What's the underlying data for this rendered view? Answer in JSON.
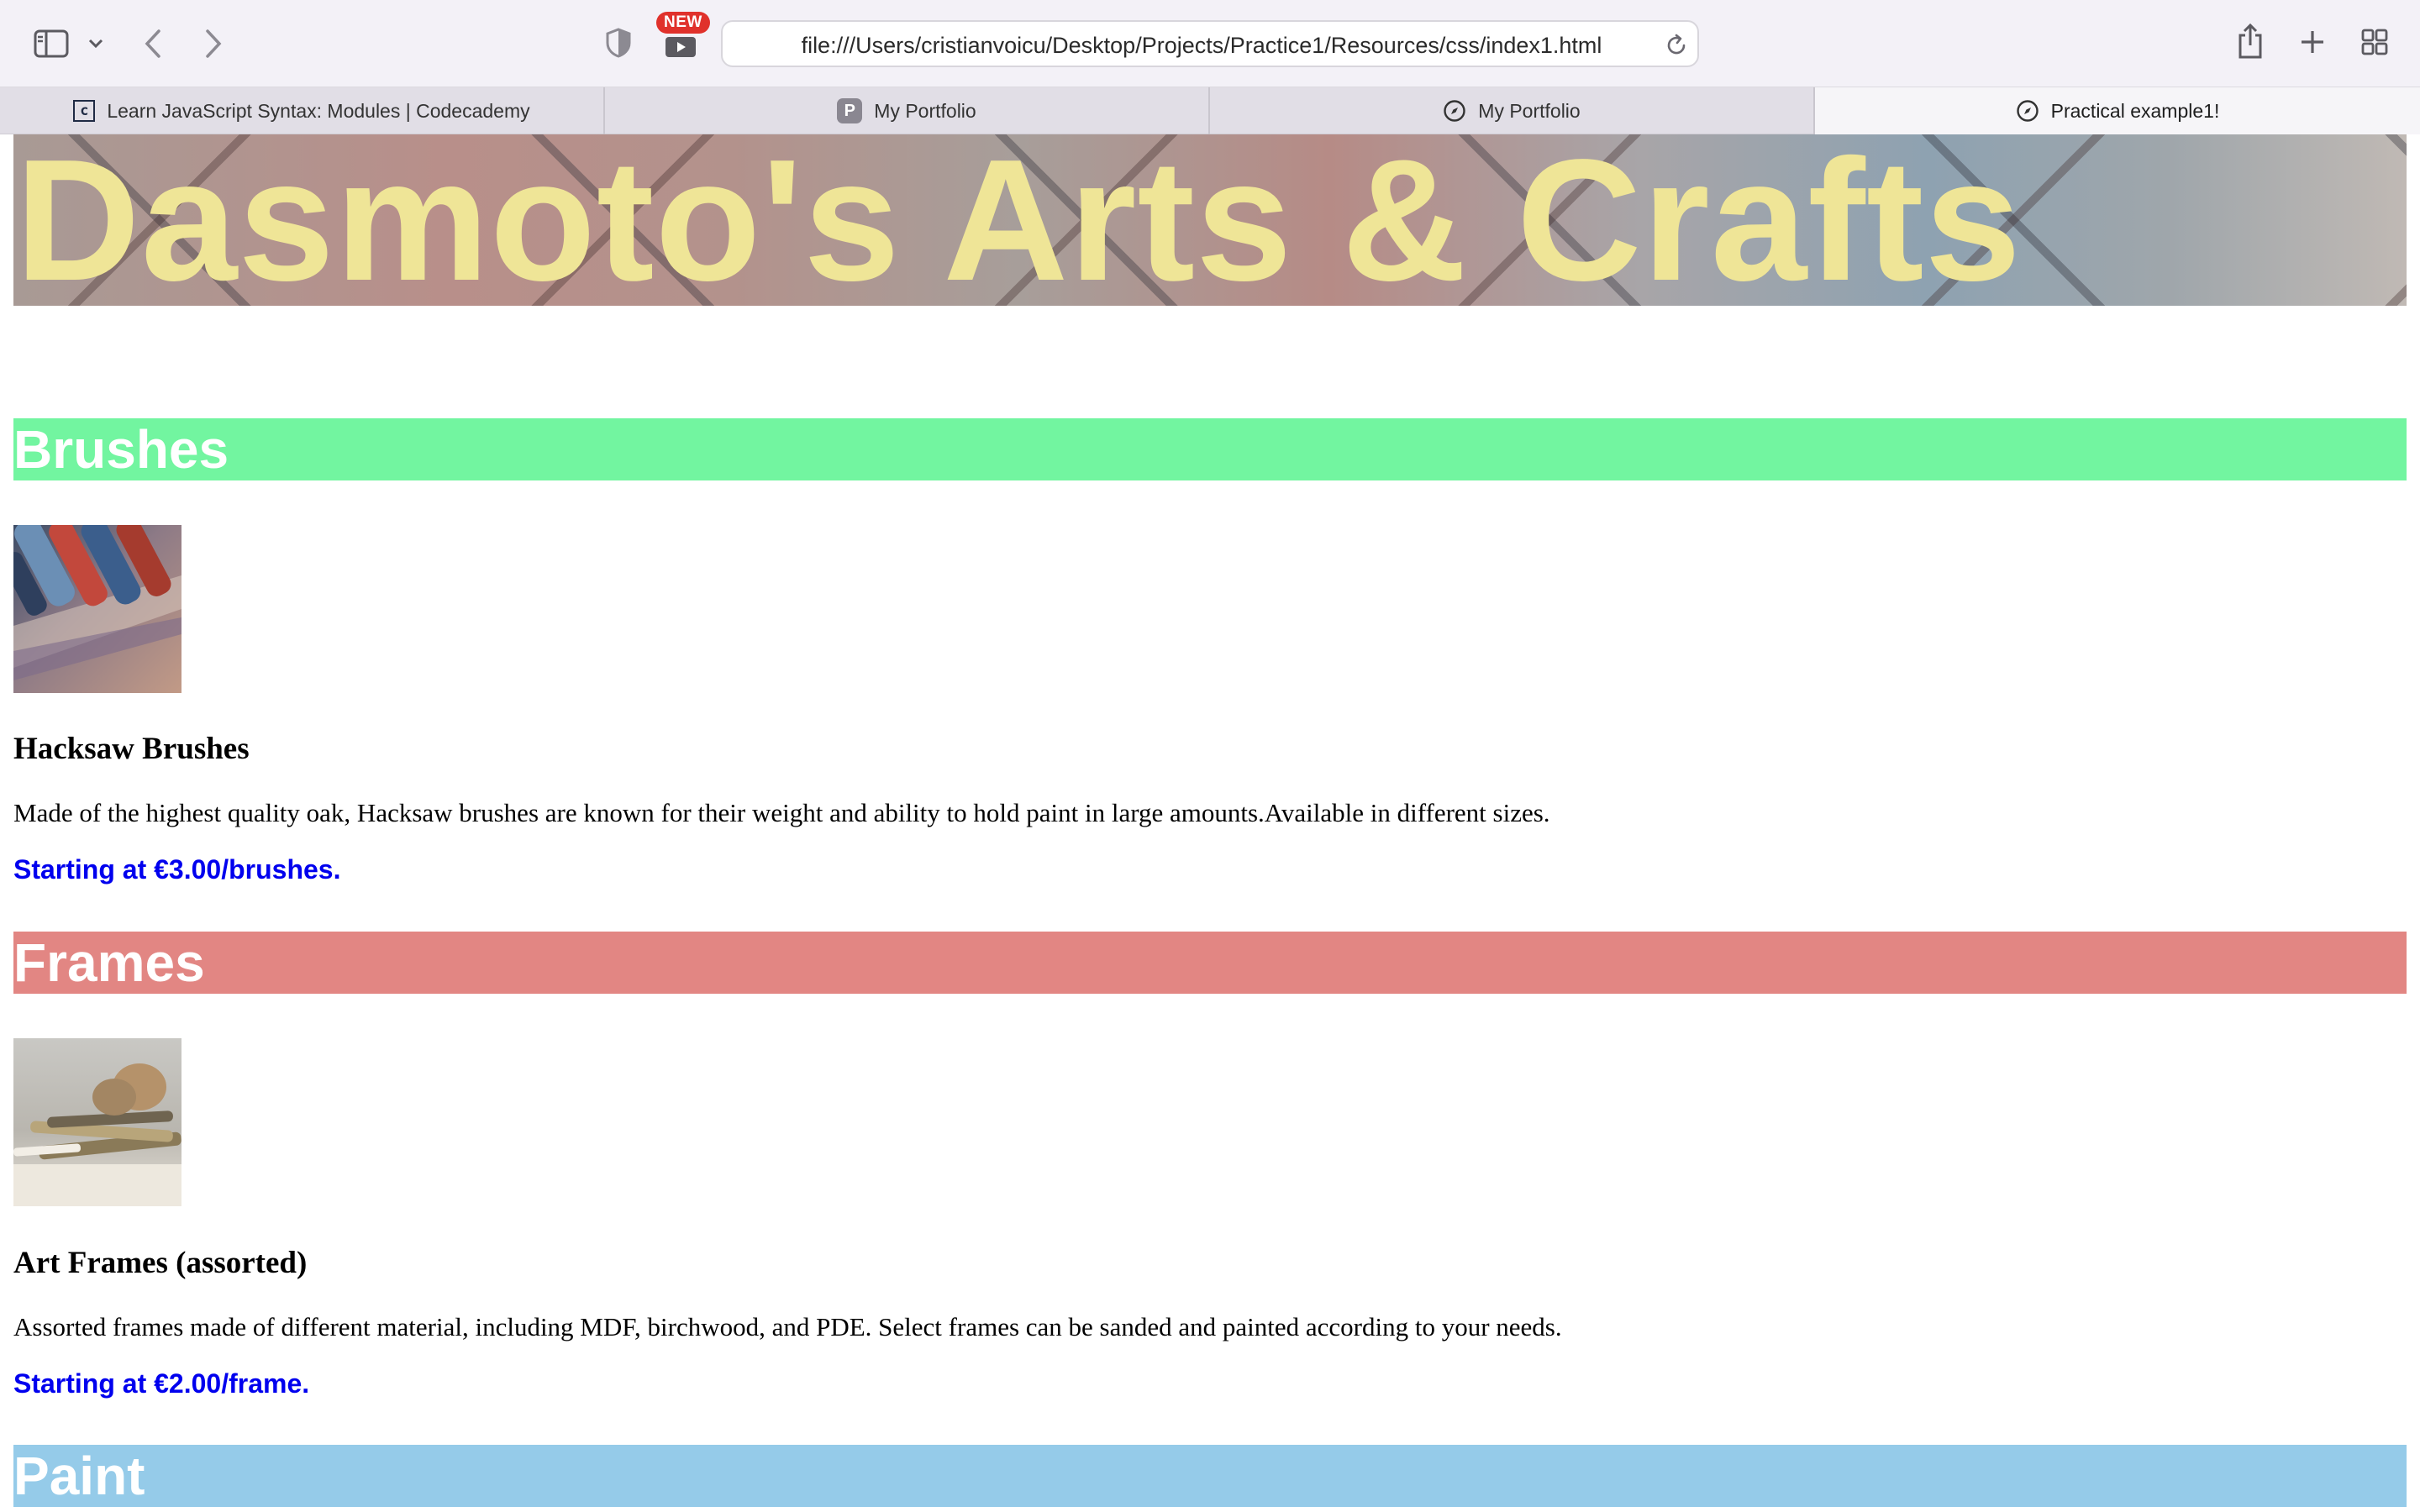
{
  "browser": {
    "address": "file:///Users/cristianvoicu/Desktop/Projects/Practice1/Resources/css/index1.html",
    "new_badge": "NEW",
    "tabs": [
      {
        "label": "Learn JavaScript Syntax: Modules | Codecademy",
        "icon": "codecademy-icon"
      },
      {
        "label": "My Portfolio",
        "icon": "p-icon"
      },
      {
        "label": "My Portfolio",
        "icon": "compass-icon"
      },
      {
        "label": "Practical example1!",
        "icon": "compass-icon"
      }
    ]
  },
  "page": {
    "title": "Dasmoto's Arts & Crafts",
    "sections": [
      {
        "heading": "Brushes",
        "color": "#72f5a0",
        "item_title": "Hacksaw Brushes",
        "description": "Made of the highest quality oak, Hacksaw brushes are known for their weight and ability to hold paint in large amounts.Available in different sizes.",
        "price": "Starting at €3.00/brushes."
      },
      {
        "heading": "Frames",
        "color": "#e28683",
        "item_title": "Art Frames (assorted)",
        "description": "Assorted frames made of different material, including MDF, birchwood, and PDE. Select frames can be sanded and painted according to your needs.",
        "price": "Starting at €2.00/frame."
      },
      {
        "heading": "Paint",
        "color": "#95cbe9"
      }
    ]
  },
  "colors": {
    "hero_title": "#efe597",
    "price_link": "#0000ee"
  }
}
